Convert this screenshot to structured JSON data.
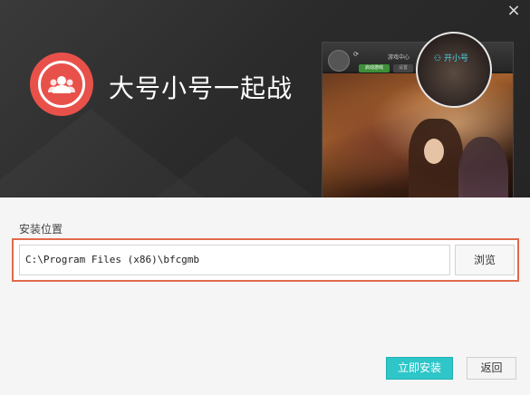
{
  "window": {
    "close_glyph": "×"
  },
  "banner": {
    "title": "大号小号一起战",
    "logo_icon": "users-icon",
    "brand_color": "#e8514a",
    "preview": {
      "tab_game_center": "游戏中心",
      "btn_start": "启动游戏",
      "btn_other": "设置",
      "lens_label": "开小号"
    }
  },
  "install": {
    "section_label": "安装位置",
    "path_value": "C:\\Program Files (x86)\\bfcgmb",
    "browse_label": "浏览",
    "highlight_color": "#e06a4c"
  },
  "footer": {
    "install_label": "立即安装",
    "back_label": "返回",
    "accent_color": "#2ec6c9"
  }
}
